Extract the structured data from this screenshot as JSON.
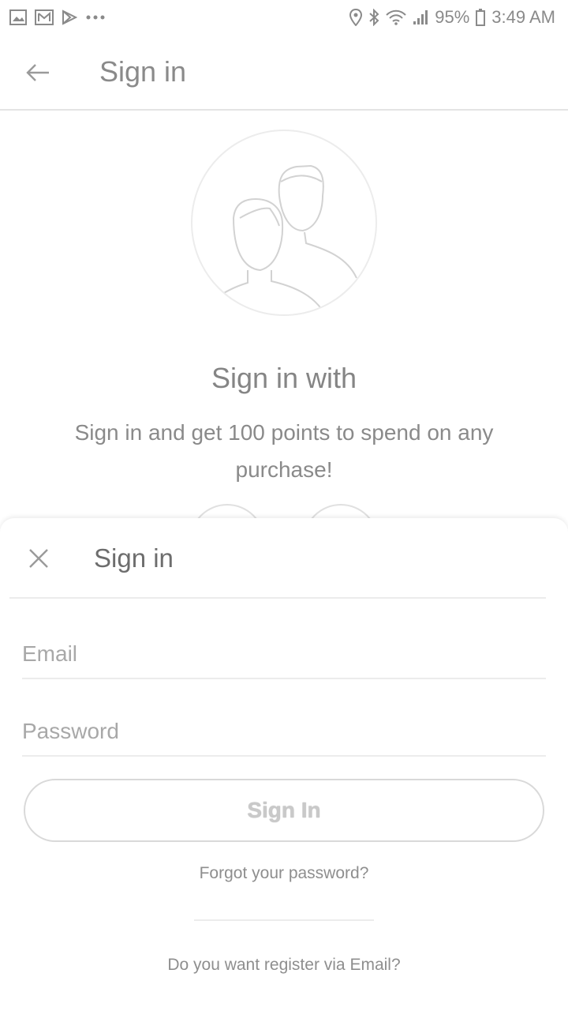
{
  "status_bar": {
    "icons": [
      "gallery-icon",
      "mail-icon",
      "play-store-icon",
      "more-dots-icon",
      "location-icon",
      "bluetooth-icon",
      "wifi-icon",
      "signal-icon",
      "battery-icon"
    ],
    "battery": "95%",
    "time": "3:49 AM"
  },
  "app_bar": {
    "title": "Sign in",
    "back_icon": "back-arrow-icon"
  },
  "hero": {
    "illustration": "users-avatar-icon",
    "heading": "Sign in with",
    "subtitle": "Sign in and get 100 points to spend on any purchase!"
  },
  "sheet": {
    "title": "Sign in",
    "close_icon": "close-icon",
    "email_placeholder": "Email",
    "password_placeholder": "Password",
    "submit_label": "Sign In",
    "forgot_link": "Forgot your password?",
    "register_link": "Do you want register via Email?"
  },
  "colors": {
    "text": "#6f6f6f",
    "divider": "#ececec",
    "button_border": "#d9d9d9"
  }
}
